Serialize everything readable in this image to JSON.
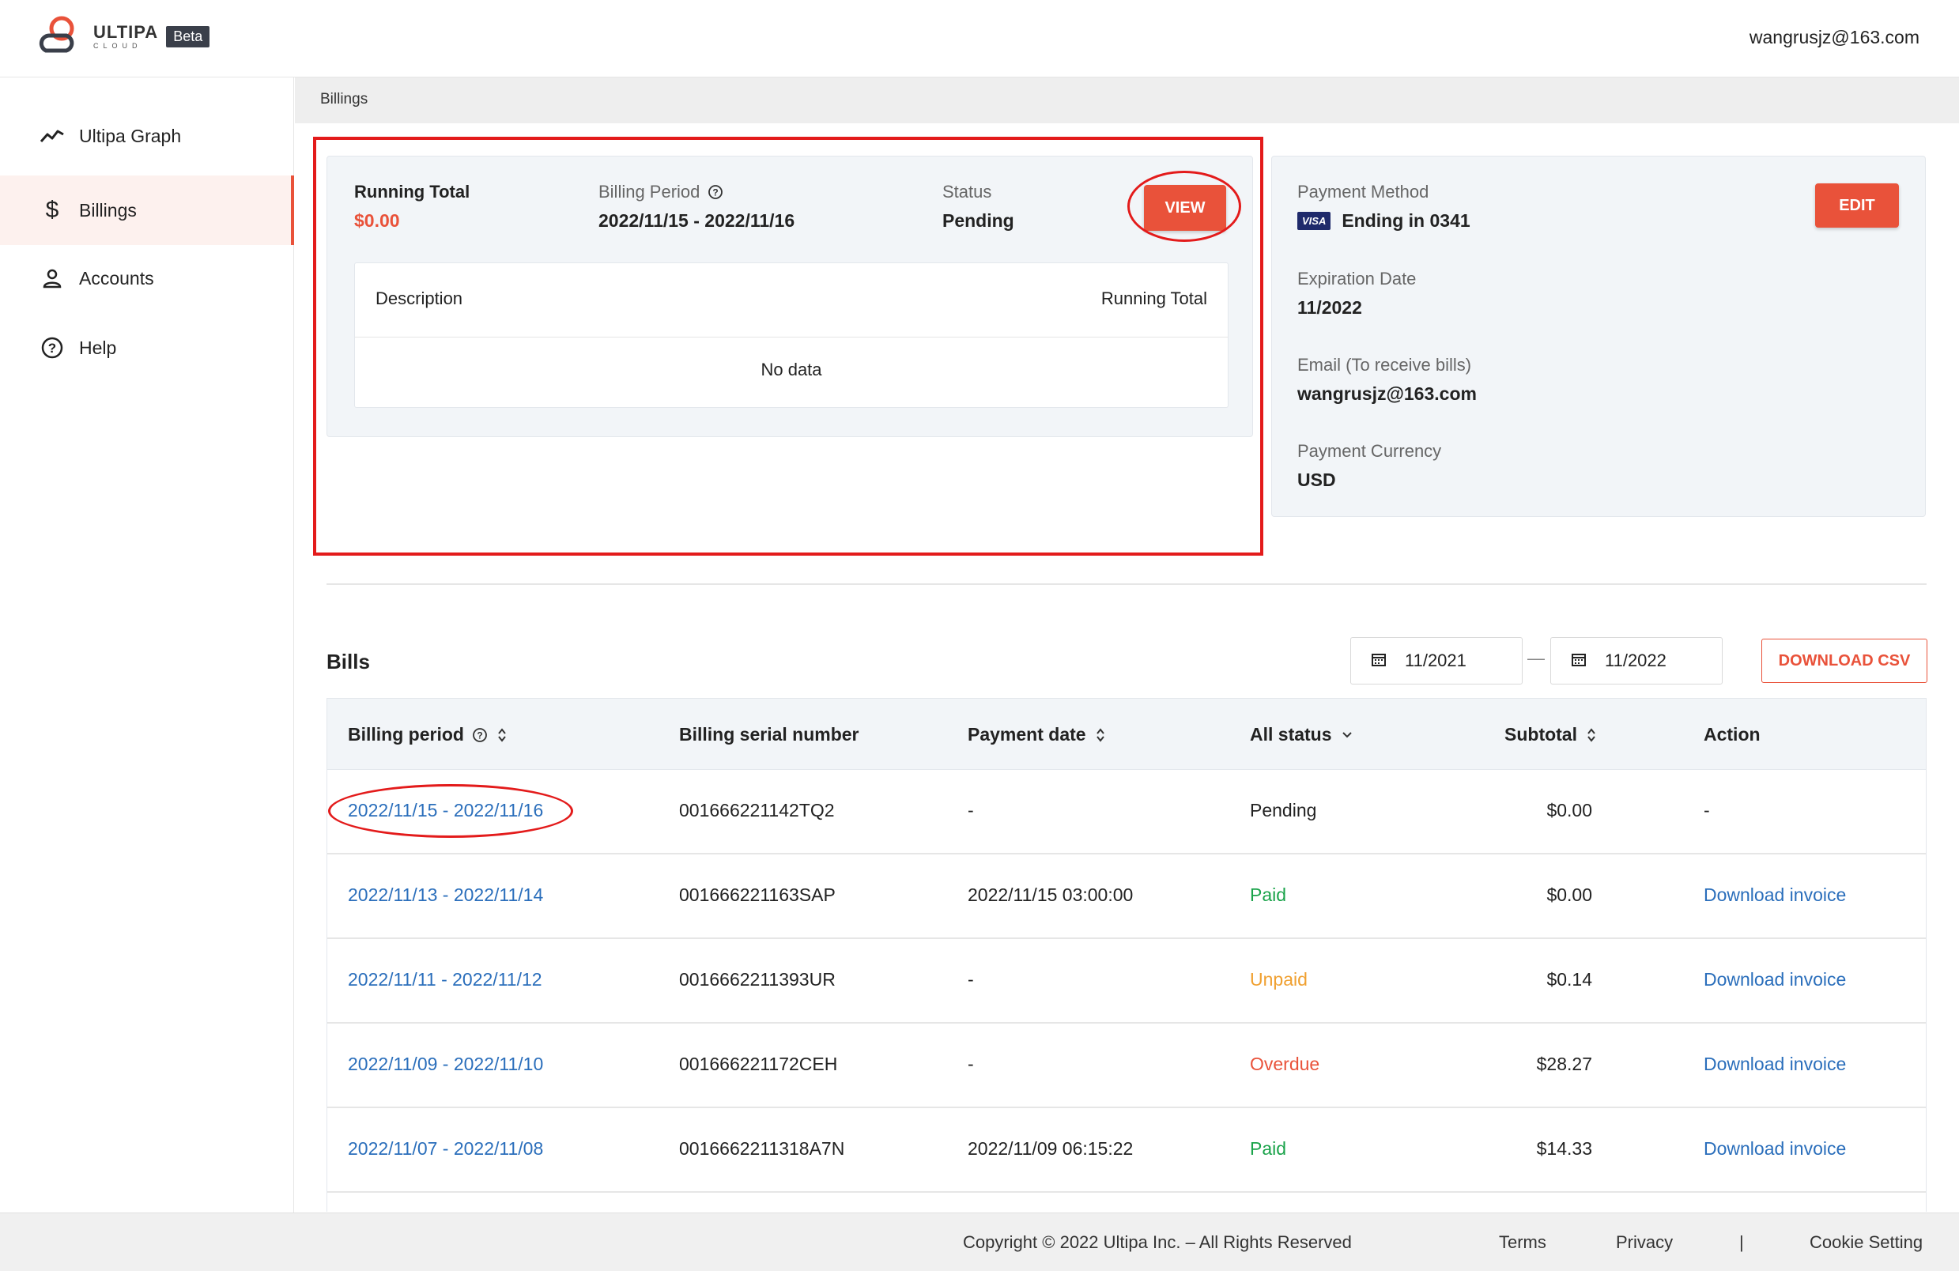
{
  "header": {
    "logo_text": "ULTIPA",
    "logo_sub": "CLOUD",
    "beta_badge": "Beta",
    "user_email": "wangrusjz@163.com"
  },
  "sidebar": {
    "items": [
      {
        "label": "Ultipa Graph",
        "icon": "trend-icon"
      },
      {
        "label": "Billings",
        "icon": "dollar-icon",
        "active": true
      },
      {
        "label": "Accounts",
        "icon": "user-icon"
      },
      {
        "label": "Help",
        "icon": "help-circle-icon"
      }
    ]
  },
  "breadcrumb": "Billings",
  "running_card": {
    "running_total_label": "Running Total",
    "running_total_value": "$0.00",
    "billing_period_label": "Billing Period",
    "billing_period_value": "2022/11/15 - 2022/11/16",
    "status_label": "Status",
    "status_value": "Pending",
    "view_button": "VIEW",
    "table": {
      "col_description": "Description",
      "col_running_total": "Running Total",
      "empty_text": "No data"
    }
  },
  "payment_card": {
    "method_label": "Payment Method",
    "card_brand": "VISA",
    "card_ending": "Ending in 0341",
    "edit_button": "EDIT",
    "expiration_label": "Expiration Date",
    "expiration_value": "11/2022",
    "email_label": "Email (To receive bills)",
    "email_value": "wangrusjz@163.com",
    "currency_label": "Payment Currency",
    "currency_value": "USD"
  },
  "bills": {
    "title": "Bills",
    "date_from": "11/2021",
    "date_sep": "—",
    "date_to": "11/2022",
    "download_csv": "DOWNLOAD CSV",
    "columns": {
      "billing_period": "Billing period",
      "serial": "Billing serial number",
      "payment_date": "Payment date",
      "status": "All status",
      "subtotal": "Subtotal",
      "action": "Action"
    },
    "rows": [
      {
        "period": "2022/11/15 - 2022/11/16",
        "serial": "001666221142TQ2",
        "payment_date": "-",
        "status": "Pending",
        "status_kind": "pending",
        "subtotal": "$0.00",
        "action": "-"
      },
      {
        "period": "2022/11/13 - 2022/11/14",
        "serial": "001666221163SAP",
        "payment_date": "2022/11/15 03:00:00",
        "status": "Paid",
        "status_kind": "paid",
        "subtotal": "$0.00",
        "action": "Download invoice"
      },
      {
        "period": "2022/11/11 - 2022/11/12",
        "serial": "0016662211393UR",
        "payment_date": "-",
        "status": "Unpaid",
        "status_kind": "unpaid",
        "subtotal": "$0.14",
        "action": "Download invoice"
      },
      {
        "period": "2022/11/09 - 2022/11/10",
        "serial": "001666221172CEH",
        "payment_date": "-",
        "status": "Overdue",
        "status_kind": "overdue",
        "subtotal": "$28.27",
        "action": "Download invoice"
      },
      {
        "period": "2022/11/07 - 2022/11/08",
        "serial": "0016662211318A7N",
        "payment_date": "2022/11/09 06:15:22",
        "status": "Paid",
        "status_kind": "paid",
        "subtotal": "$14.33",
        "action": "Download invoice"
      }
    ]
  },
  "footer": {
    "copyright": "Copyright © 2022 Ultipa Inc. – All Rights Reserved",
    "terms": "Terms",
    "privacy": "Privacy",
    "separator": "|",
    "cookie": "Cookie Setting"
  },
  "colors": {
    "accent": "#e9523a",
    "link": "#2a6ebb",
    "paid": "#1aa34a",
    "unpaid": "#f0a030",
    "overdue": "#e9523a",
    "annotation": "#e31b1b"
  }
}
